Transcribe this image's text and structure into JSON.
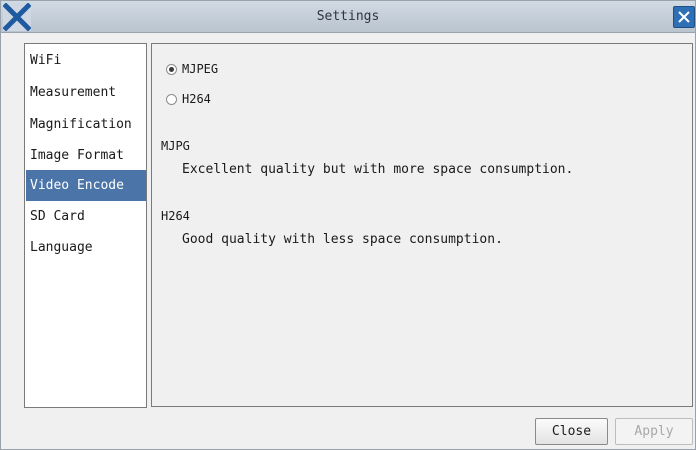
{
  "window": {
    "title": "Settings"
  },
  "sidebar": {
    "items": [
      {
        "label": "WiFi"
      },
      {
        "label": "Measurement"
      },
      {
        "label": "Magnification"
      },
      {
        "label": "Image Format"
      },
      {
        "label": "Video Encode",
        "selected": true
      },
      {
        "label": "SD Card"
      },
      {
        "label": "Language"
      }
    ]
  },
  "panel": {
    "options": [
      {
        "label": "MJPEG",
        "checked": true
      },
      {
        "label": "H264",
        "checked": false
      }
    ],
    "descriptions": [
      {
        "title": "MJPG",
        "text": "Excellent quality but with more space consumption."
      },
      {
        "title": "H264",
        "text": "Good quality with less space consumption."
      }
    ]
  },
  "buttons": {
    "close_label": "Close",
    "apply_label": "Apply"
  },
  "colors": {
    "selection": "#4b75a8",
    "title_bar": "#c5ced8",
    "close_button": "#2f6fb5"
  }
}
